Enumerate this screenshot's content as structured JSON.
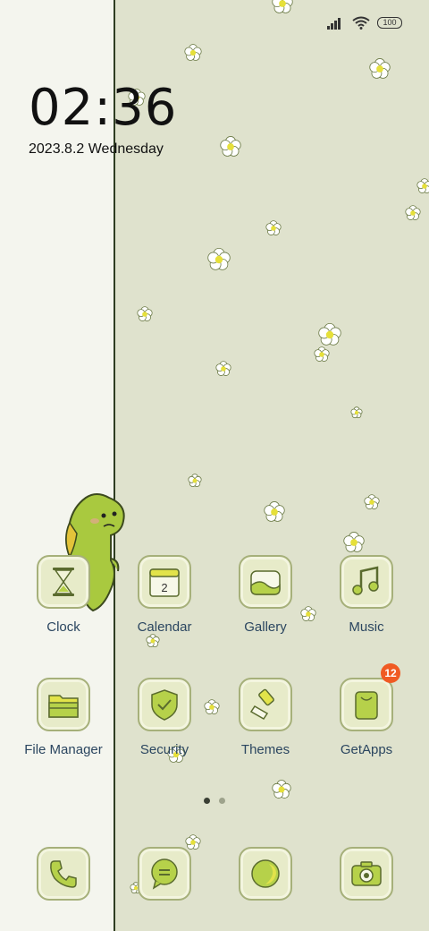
{
  "status_bar": {
    "battery": "100",
    "signal_icon": "signal-icon",
    "wifi_icon": "wifi-icon"
  },
  "clock": {
    "time": "02:36",
    "date": "2023.8.2 Wednesday"
  },
  "apps_row1": [
    {
      "label": "Clock",
      "icon": "hourglass-icon"
    },
    {
      "label": "Calendar",
      "icon": "calendar-icon",
      "day": "2"
    },
    {
      "label": "Gallery",
      "icon": "gallery-icon"
    },
    {
      "label": "Music",
      "icon": "music-note-icon"
    }
  ],
  "apps_row2": [
    {
      "label": "File Manager",
      "icon": "folder-icon"
    },
    {
      "label": "Security",
      "icon": "shield-icon"
    },
    {
      "label": "Themes",
      "icon": "brush-icon"
    },
    {
      "label": "GetApps",
      "icon": "shopping-bag-icon",
      "badge": "12"
    }
  ],
  "dock": [
    {
      "name": "Phone",
      "icon": "phone-icon"
    },
    {
      "name": "Messages",
      "icon": "message-icon"
    },
    {
      "name": "Browser",
      "icon": "moon-icon"
    },
    {
      "name": "Camera",
      "icon": "camera-icon"
    }
  ],
  "page_indicator": {
    "pages": 2,
    "active": 1
  },
  "colors": {
    "accent_green": "#b6d14a",
    "label_text": "#2b4660",
    "badge": "#f05a23"
  }
}
